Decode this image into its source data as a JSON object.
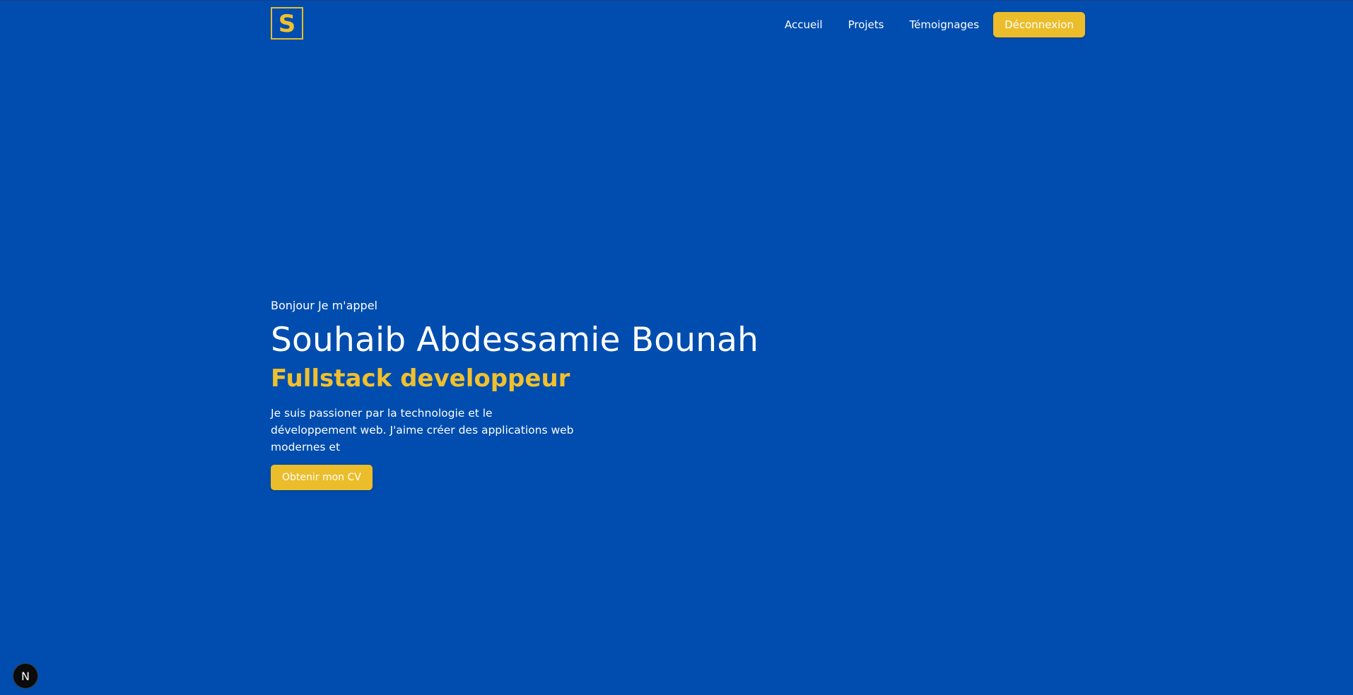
{
  "header": {
    "logo_letter": "S",
    "nav": [
      {
        "label": "Accueil"
      },
      {
        "label": "Projets"
      },
      {
        "label": "Témoignages"
      }
    ],
    "logout_label": "Déconnexion"
  },
  "hero": {
    "greeting": "Bonjour Je m'appel",
    "name": "Souhaib Abdessamie Bounah",
    "role": "Fullstack developpeur",
    "description": "Je suis passioner par la technologie et le développement web. J'aime créer des applications web modernes et",
    "cv_button": "Obtenir mon CV"
  },
  "badge": {
    "letter": "N"
  },
  "colors": {
    "background": "#004daf",
    "accent": "#ebbd2b",
    "text": "#ffffff"
  }
}
